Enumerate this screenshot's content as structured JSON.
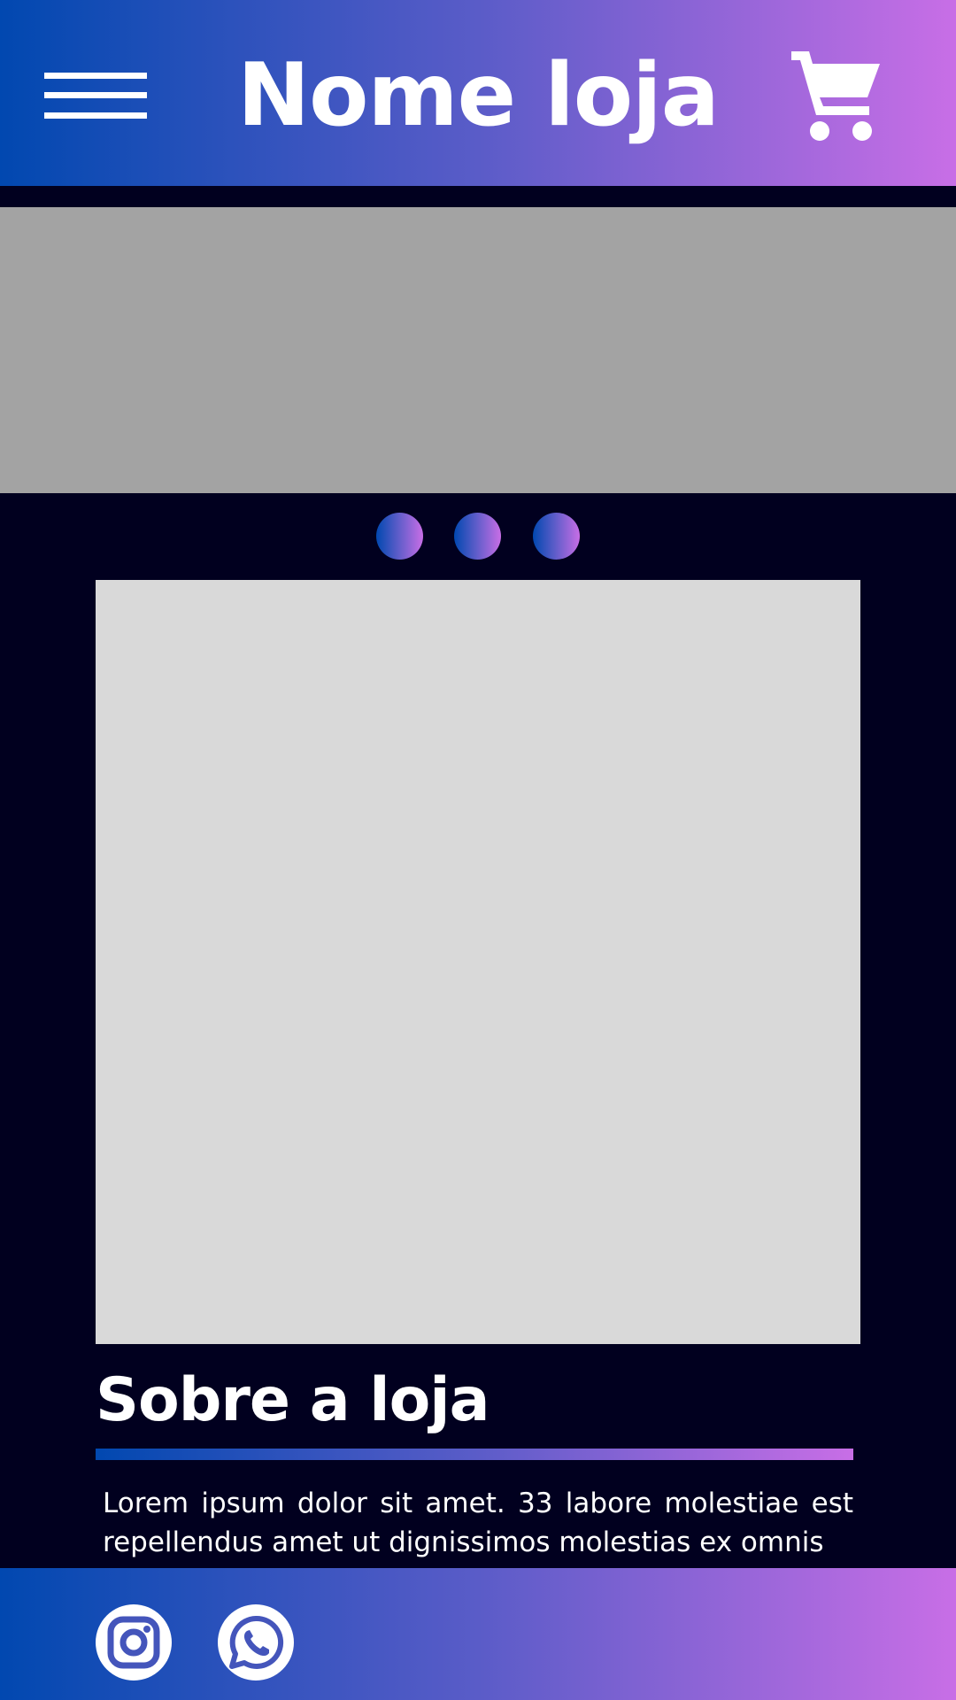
{
  "header": {
    "title": "Nome loja",
    "menu_icon": "hamburger-menu-icon",
    "cart_icon": "shopping-cart-icon"
  },
  "carousel": {
    "dots": 3
  },
  "about": {
    "title": "Sobre a loja",
    "text": "Lorem ipsum dolor sit amet. 33 labore molestiae est repellendus amet ut dignissimos molestias ex omnis"
  },
  "footer": {
    "social": [
      "instagram-icon",
      "whatsapp-icon"
    ]
  },
  "colors": {
    "background": "#01001f",
    "gradient_start": "#0148b0",
    "gradient_mid": "#5a5cc8",
    "gradient_end": "#c86ee6",
    "banner_placeholder": "#a3a3a3",
    "image_placeholder": "#d9d9d9",
    "text": "#ffffff"
  }
}
